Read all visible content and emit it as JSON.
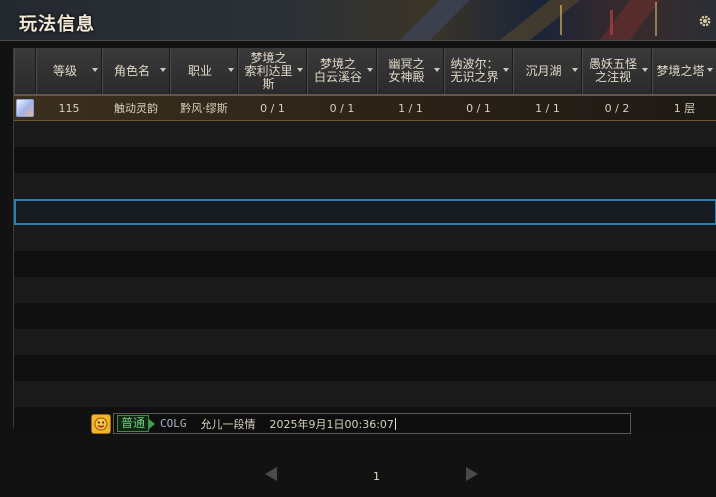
{
  "header": {
    "title": "玩法信息"
  },
  "columns": [
    {
      "label": "",
      "w": 22
    },
    {
      "label": "等级",
      "w": 66
    },
    {
      "label": "角色名",
      "w": 68
    },
    {
      "label": "职业",
      "w": 68
    },
    {
      "label": "梦境之\n索利达里\n斯",
      "w": 69
    },
    {
      "label": "梦境之\n白云溪谷",
      "w": 70
    },
    {
      "label": "幽冥之\n女神殿",
      "w": 67
    },
    {
      "label": "纳波尔：\n无识之界",
      "w": 69
    },
    {
      "label": "沉月湖",
      "w": 69
    },
    {
      "label": "愚妖五怪\n之注视",
      "w": 70
    },
    {
      "label": "梦境之塔",
      "w": 65
    }
  ],
  "rows": [
    [
      "",
      "115",
      "触动灵韵",
      "黔风·缪斯",
      "0 / 1",
      "0 / 1",
      "1 / 1",
      "0 / 1",
      "1 / 1",
      "0 / 2",
      "1 层"
    ]
  ],
  "chat": {
    "channel": "普通",
    "name": "COLG",
    "message": "允儿一段情",
    "time": "2025年9月1日00:36:07"
  },
  "pager": {
    "page": "1"
  },
  "colors": {
    "selected_border": "#6a5a3a",
    "hover_outline": "#2c7db3",
    "channel_green": "#6fd07a"
  }
}
